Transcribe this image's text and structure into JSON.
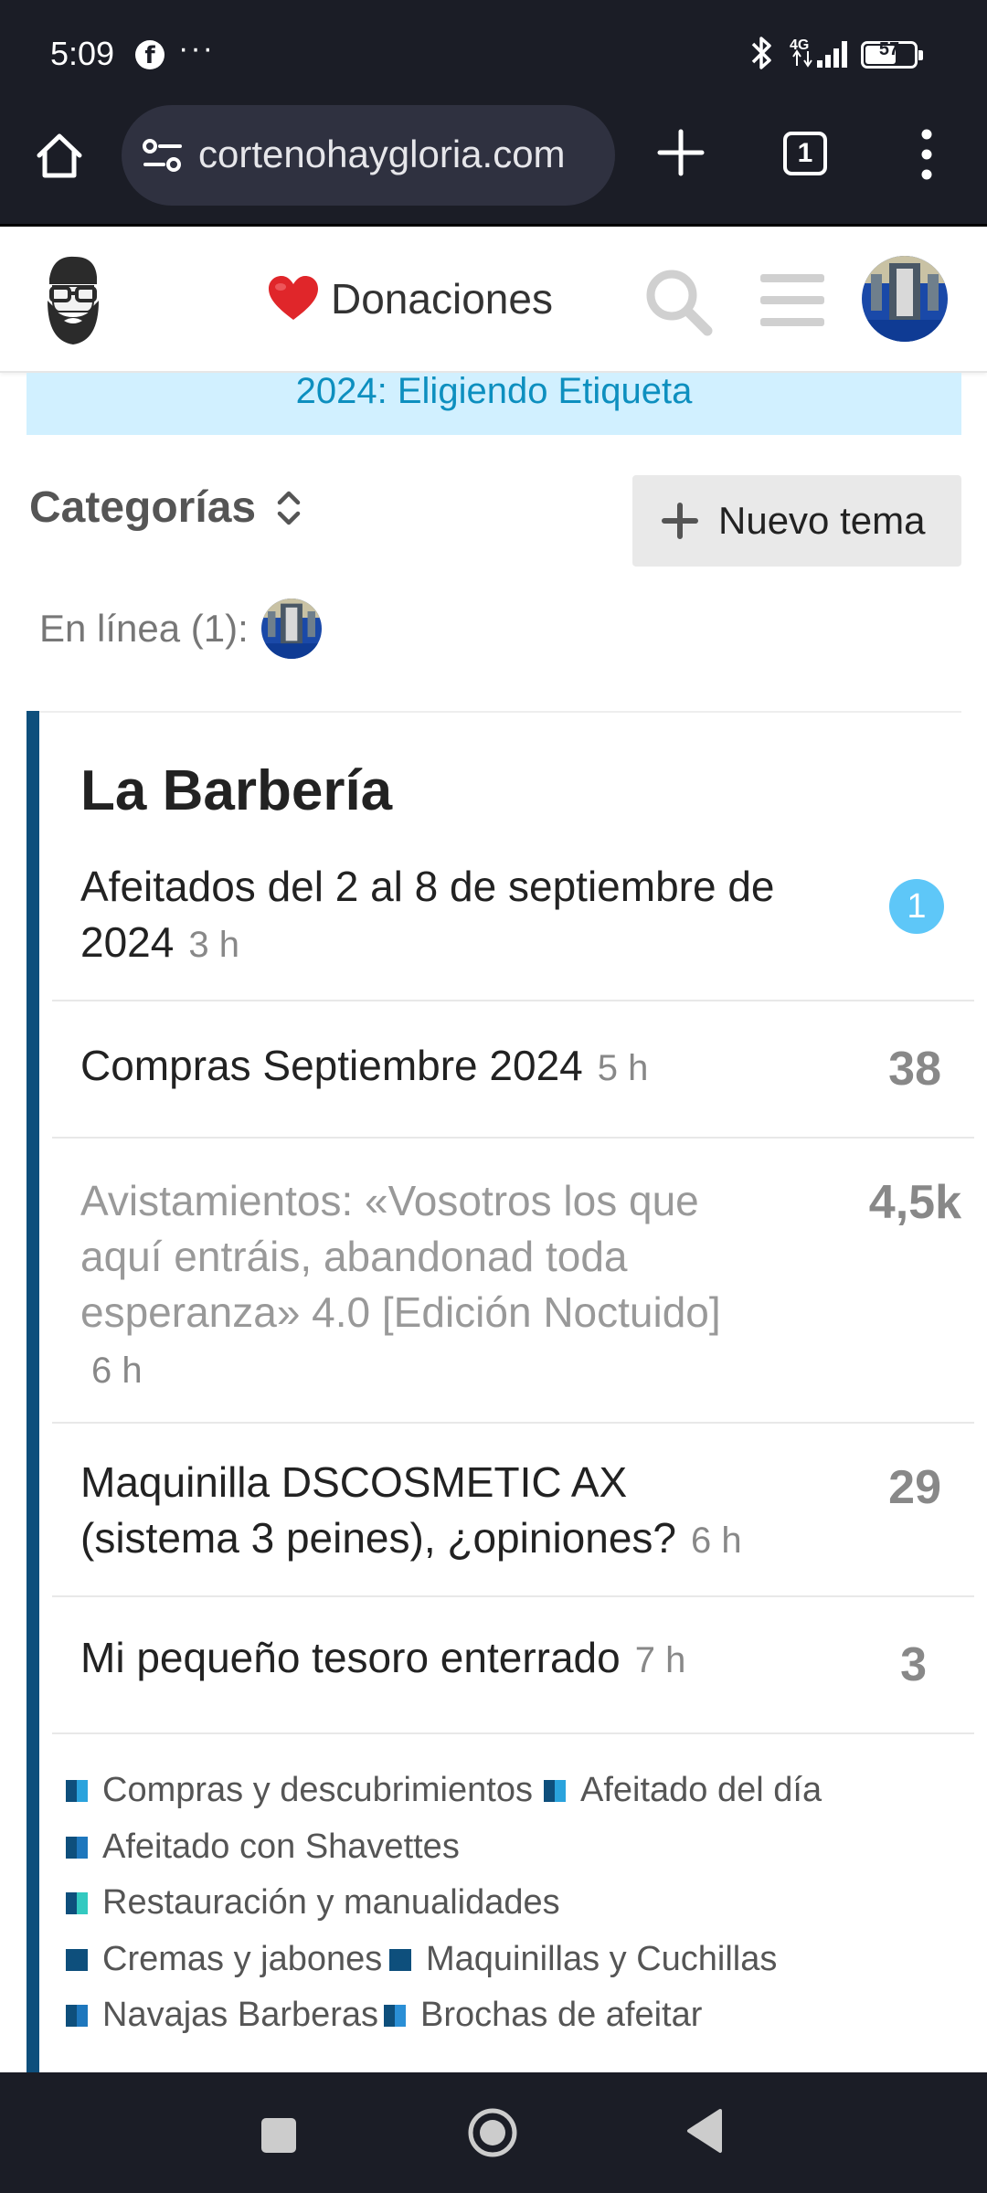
{
  "status_bar": {
    "time": "5:09",
    "more": "···",
    "network": "4G",
    "battery": "57"
  },
  "browser": {
    "url": "cortenohaygloria.com",
    "tab_count": "1"
  },
  "header": {
    "donate_label": "Donaciones"
  },
  "banner": {
    "text": "2024: Eligiendo Etiqueta"
  },
  "controls": {
    "categories_label": "Categorías",
    "new_topic_label": "Nuevo tema",
    "online_label": "En línea (1):"
  },
  "category": {
    "title": "La Barbería",
    "color": "#0e4f7c",
    "topics": [
      {
        "line1": "Afeitados del 2 al 8 de septiembre de",
        "line2": "2024",
        "age": "3 h",
        "new_count": "1"
      },
      {
        "line1": "Compras Septiembre 2024",
        "age": "5 h",
        "count": "38"
      },
      {
        "line1": "Avistamientos: «Vosotros los que",
        "line2": "aquí entráis, abandonad toda",
        "line3": "esperanza» 4.0 [Edición Noctuido]",
        "age": "6 h",
        "count": "4,5k"
      },
      {
        "line1": "Maquinilla DSCOSMETIC AX",
        "line2": "(sistema 3 peines), ¿opiniones?",
        "age": "6 h",
        "count": "29"
      },
      {
        "line1": "Mi pequeño tesoro enterrado",
        "age": "7 h",
        "count": "3"
      }
    ],
    "subcategories": [
      {
        "name": "Compras y descubrimientos",
        "colors": [
          "#0e4f7c",
          "#2aa3dd"
        ]
      },
      {
        "name": "Afeitado del día",
        "colors": [
          "#0e4f7c",
          "#2aa3dd"
        ]
      },
      {
        "name": "Afeitado con Shavettes",
        "colors": [
          "#0e4f7c",
          "#1e77bd"
        ]
      },
      {
        "name": "Restauración y manualidades",
        "colors": [
          "#0e4f7c",
          "#33c9c0"
        ]
      },
      {
        "name": "Cremas y jabones",
        "colors": [
          "#0e4f7c",
          "#0e4f7c"
        ]
      },
      {
        "name": "Maquinillas y Cuchillas",
        "colors": [
          "#0e4f7c",
          "#0e4f7c"
        ]
      },
      {
        "name": "Navajas Barberas",
        "colors": [
          "#0e4f7c",
          "#1e77bd"
        ]
      },
      {
        "name": "Brochas de afeitar",
        "colors": [
          "#0e4f7c",
          "#2a8fd6"
        ]
      }
    ]
  },
  "colors": {
    "system_bar": "#1b1d26",
    "banner_bg": "#d1f0ff",
    "banner_text": "#0d8fbf",
    "new_badge": "#5ec7f8"
  }
}
